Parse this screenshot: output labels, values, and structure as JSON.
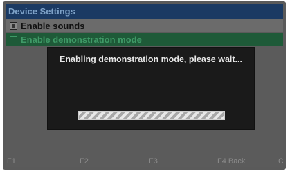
{
  "window": {
    "title": "Device Settings"
  },
  "menu": {
    "items": [
      {
        "label": "Enable sounds",
        "checked": true
      },
      {
        "label": "Enable demonstration mode",
        "checked": false,
        "selected": true
      }
    ]
  },
  "dialog": {
    "message": "Enabling demonstration mode, please wait..."
  },
  "footer": {
    "keys": [
      "F1",
      "F2",
      "F3",
      "F4 Back",
      "C"
    ]
  }
}
